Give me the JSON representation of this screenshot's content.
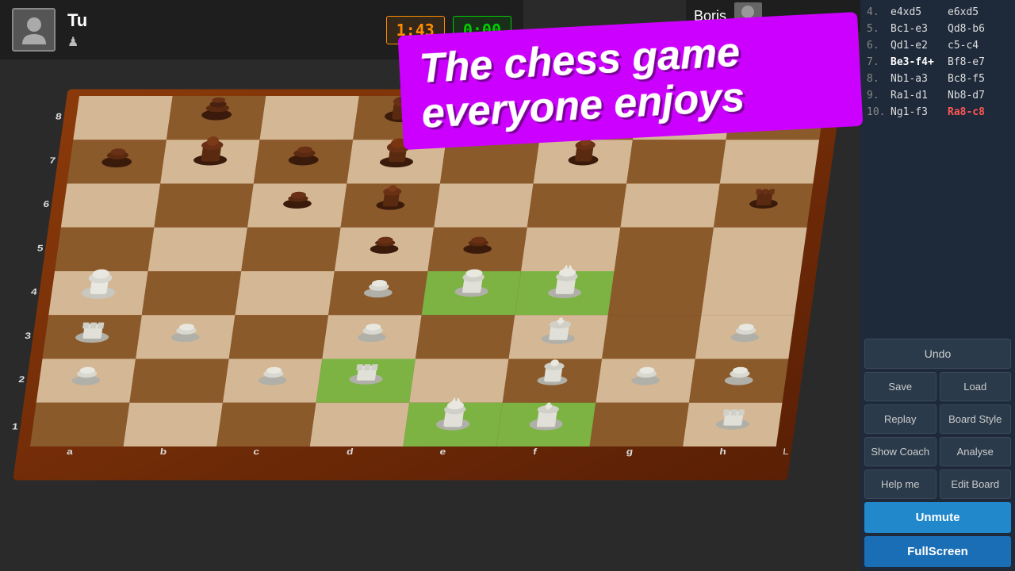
{
  "players": {
    "white": {
      "name": "Tu",
      "avatar_icon": "person-icon",
      "piece_icon": "♟"
    },
    "black": {
      "name": "Boris",
      "avatar_icon": "person-icon"
    }
  },
  "timers": {
    "white": "1:43",
    "black": "0:00"
  },
  "promo": {
    "line1": "The chess game",
    "line2": "everyone enjoys"
  },
  "moves": [
    {
      "num": "4.",
      "white": "e4xd5",
      "black": "e6xd5",
      "white_bold": false,
      "black_highlight": false
    },
    {
      "num": "5.",
      "white": "Bc1-e3",
      "black": "Qd8-b6",
      "white_bold": false,
      "black_highlight": false
    },
    {
      "num": "6.",
      "white": "Qd1-e2",
      "black": "c5-c4",
      "white_bold": false,
      "black_highlight": false
    },
    {
      "num": "7.",
      "white": "Be3-f4+",
      "black": "Bf8-e7",
      "white_bold": true,
      "black_highlight": false
    },
    {
      "num": "8.",
      "white": "Nb1-a3",
      "black": "Bc8-f5",
      "white_bold": false,
      "black_highlight": false
    },
    {
      "num": "9.",
      "white": "Ra1-d1",
      "black": "Nb8-d7",
      "white_bold": false,
      "black_highlight": false
    },
    {
      "num": "10.",
      "white": "Ng1-f3",
      "black": "Ra8-c8",
      "white_bold": false,
      "black_highlight": true
    }
  ],
  "buttons": {
    "undo": "Undo",
    "save": "Save",
    "load": "Load",
    "replay": "Replay",
    "board_style": "Board Style",
    "show_coach": "Show Coach",
    "analyse": "Analyse",
    "help_me": "Help me",
    "edit_board": "Edit Board",
    "unmute": "Unmute",
    "fullscreen": "FullScreen"
  },
  "board": {
    "ranks": [
      "8",
      "7",
      "6",
      "5",
      "4",
      "3",
      "2",
      "1"
    ],
    "files": [
      "a",
      "b",
      "c",
      "d",
      "e",
      "f",
      "g",
      "h"
    ],
    "highlighted_cells": [
      "e4",
      "f4",
      "e6",
      "f6",
      "d5"
    ]
  }
}
